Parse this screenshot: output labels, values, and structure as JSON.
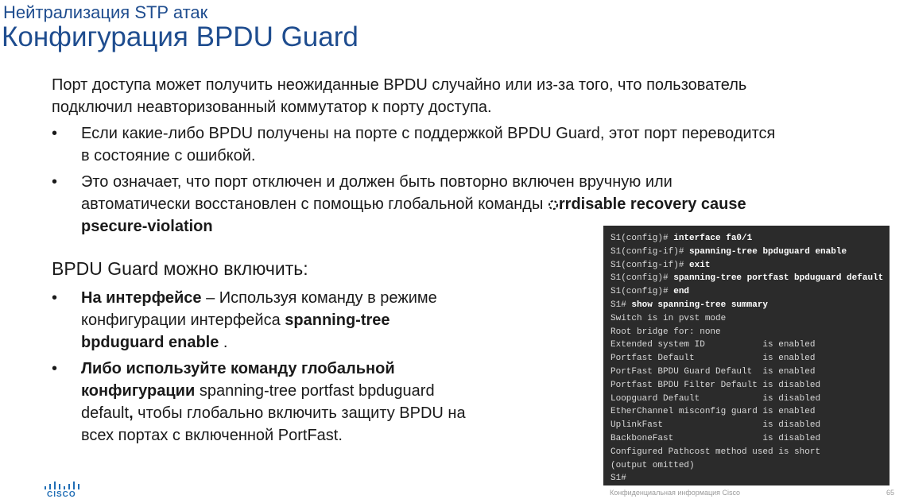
{
  "header": {
    "subtitle": "Нейтрализация STP атак",
    "title": "Конфигурация BPDU Guard"
  },
  "intro": {
    "line1": "Порт доступа может получить неожиданные BPDU случайно или из-за того, что пользователь",
    "line2": "подключил неавторизованный коммутатор к порту доступа."
  },
  "bullets_top": [
    {
      "line1": "Если какие-либо BPDU получены на порте с поддержкой BPDU Guard, этот порт переводится",
      "line2": "в состояние с ошибкой."
    },
    {
      "line1": "Это означает, что порт отключен и должен быть повторно включен вручную или",
      "line2_plain": "автоматически восстановлен с помощью глобальной команды ",
      "line2_bold": "rrdisable recovery cause",
      "line3_bold": "psecure-violation"
    }
  ],
  "enable_heading": "BPDU Guard можно включить:",
  "bullets_bottom": [
    {
      "l1_bold": "На интерфейсе",
      "l1_plain": " – Используя команду в режиме",
      "l2_plain": "конфигурации интерфейса ",
      "l2_bold": "spanning-tree",
      "l3_bold": "bpduguard enable",
      "l3_plain": " ."
    },
    {
      "l1_bold": "Либо используйте команду глобальной",
      "l2_bold": "конфигурации",
      "l2_plain": " spanning-tree portfast bpduguard",
      "l3_plain_a": "default",
      "l3_bold": ",",
      "l3_plain_b": " чтобы глобально включить защиту BPDU на",
      "l4_plain": "всех портах с включенной PortFast."
    }
  ],
  "terminal": [
    {
      "prompt": "S1(config)# ",
      "cmd": "interface fa0/1"
    },
    {
      "prompt": "S1(config-if)# ",
      "cmd": "spanning-tree bpduguard enable"
    },
    {
      "prompt": "S1(config-if)# ",
      "cmd": "exit"
    },
    {
      "prompt": "S1(config)# ",
      "cmd": "spanning-tree portfast bpduguard default"
    },
    {
      "prompt": "S1(config)# ",
      "cmd": "end"
    },
    {
      "prompt": "S1# ",
      "cmd": "show spanning-tree summary"
    },
    {
      "prompt": "Switch is in pvst mode",
      "cmd": ""
    },
    {
      "prompt": "Root bridge for: none",
      "cmd": ""
    },
    {
      "prompt": "Extended system ID           is enabled",
      "cmd": ""
    },
    {
      "prompt": "Portfast Default             is enabled",
      "cmd": ""
    },
    {
      "prompt": "PortFast BPDU Guard Default  is enabled",
      "cmd": ""
    },
    {
      "prompt": "Portfast BPDU Filter Default is disabled",
      "cmd": ""
    },
    {
      "prompt": "Loopguard Default            is disabled",
      "cmd": ""
    },
    {
      "prompt": "EtherChannel misconfig guard is enabled",
      "cmd": ""
    },
    {
      "prompt": "UplinkFast                   is disabled",
      "cmd": ""
    },
    {
      "prompt": "BackboneFast                 is disabled",
      "cmd": ""
    },
    {
      "prompt": "Configured Pathcost method used is short",
      "cmd": ""
    },
    {
      "prompt": "(output omitted)",
      "cmd": ""
    },
    {
      "prompt": "S1#",
      "cmd": ""
    }
  ],
  "footer": {
    "confidential": "Конфиденциальная информация Cisco",
    "page": "65",
    "logo_text": "CISCO"
  },
  "colors": {
    "title": "#1f4d8f",
    "terminal_bg": "#2b2b2b",
    "logo": "#1f6db5"
  }
}
